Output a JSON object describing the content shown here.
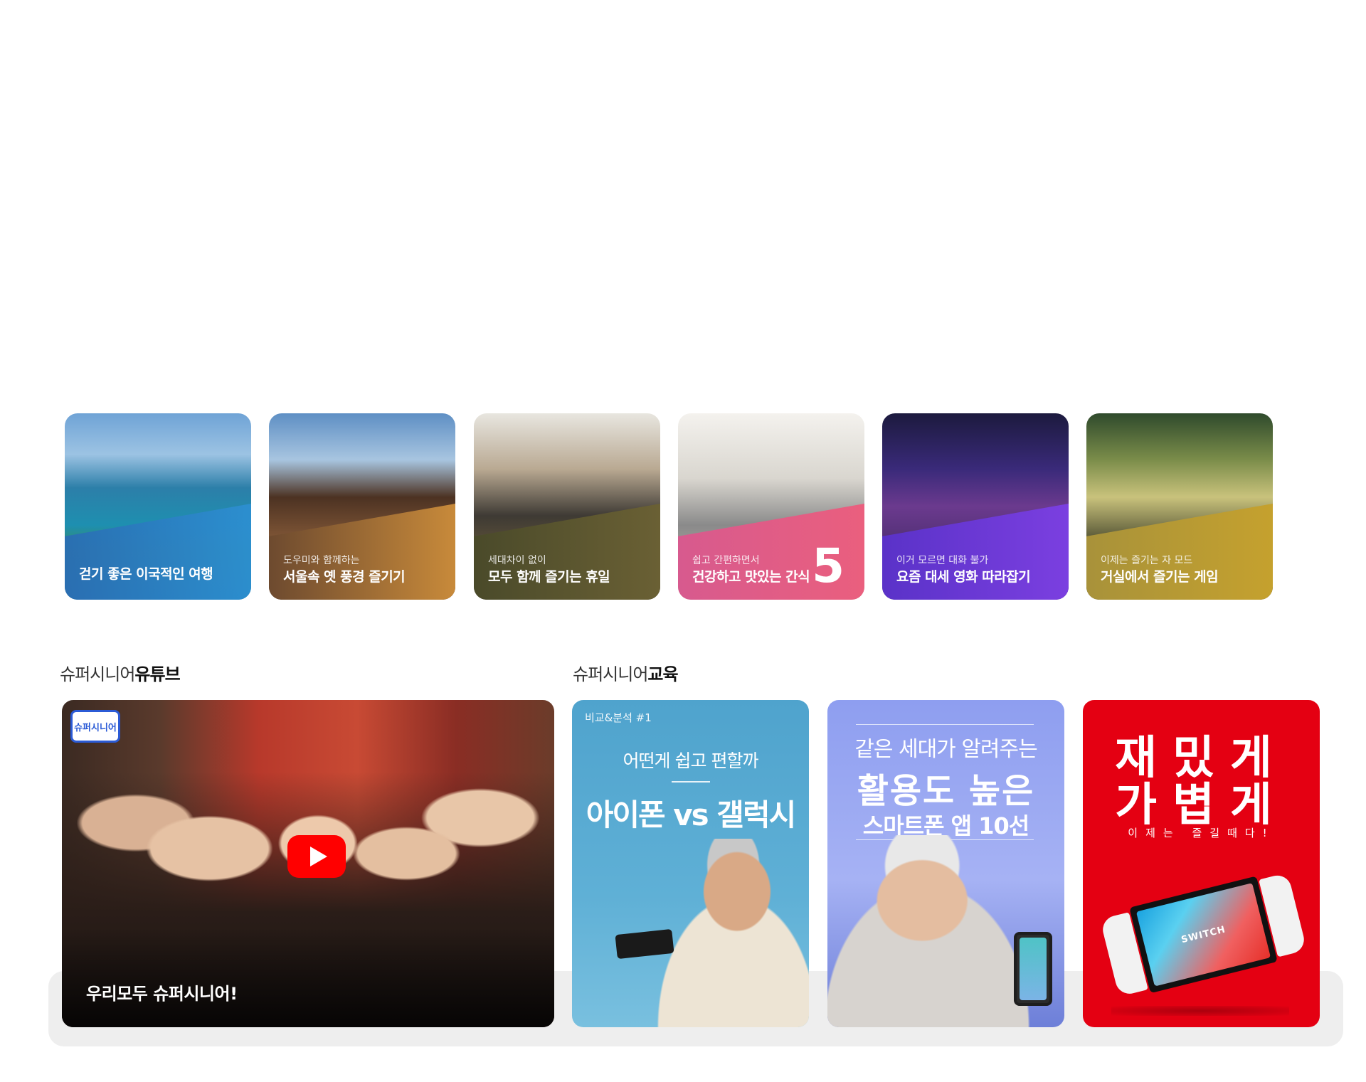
{
  "cards": [
    {
      "sub": "",
      "title": "걷기 좋은 이국적인 여행",
      "image": "jeju-wind-turbines-coast"
    },
    {
      "sub": "도우미와 함께하는",
      "title": "서울속 옛 풍경 즐기기",
      "image": "hanok-rooftops"
    },
    {
      "sub": "세대차이 없이",
      "title": "모두 함께 즐기는 휴일",
      "image": "grandfather-walking-with-child"
    },
    {
      "sub": "쉽고 간편하면서",
      "title": "건강하고 맛있는 간식",
      "badge": "5",
      "image": "grandfather-cooking-with-girl"
    },
    {
      "sub": "이거 모르면 대화 불가",
      "title": "요즘 대세 영화 따라잡기",
      "image": "superhero-movie-poster"
    },
    {
      "sub": "이제는 즐기는 자 모드",
      "title": "거실에서 즐기는 게임",
      "image": "fantasy-game-landscape"
    }
  ],
  "youtube": {
    "heading_light": "슈퍼시니어",
    "heading_bold": "유튜브",
    "logo_text": "슈퍼시니어",
    "caption": "우리모두 슈퍼시니어!",
    "play_icon": "play-button-icon"
  },
  "education": {
    "heading_light": "슈퍼시니어",
    "heading_bold": "교육",
    "items": [
      {
        "tag": "비교&분석 #1",
        "question": "어떤게 쉽고 편할까",
        "headline": "아이폰 vs 갤럭시"
      },
      {
        "line1": "같은 세대가 알려주는",
        "line2": "활용도 높은",
        "line3": "스마트폰 앱 10선"
      },
      {
        "line1": "재밌게",
        "line2": "가볍게",
        "line3": "이제는 즐길때다!",
        "device_logo": "SWITCH"
      }
    ]
  },
  "colors": {
    "youtube_red": "#ff0000",
    "edu_red": "#e40012",
    "backdrop": "#eeeeee"
  }
}
